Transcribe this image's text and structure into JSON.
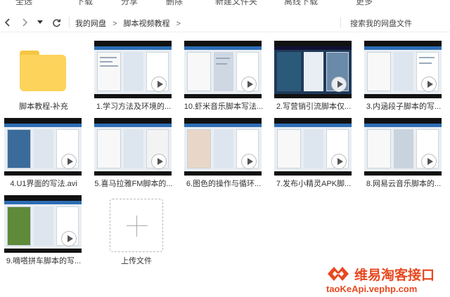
{
  "toolbar": {
    "items": [
      "全选",
      "下载",
      "分享",
      "删除",
      "新建文件夹",
      "离线下载",
      "更多"
    ]
  },
  "nav": {
    "back_icon": "chevron-left-icon",
    "forward_icon": "chevron-right-icon",
    "history_icon": "caret-down-icon",
    "refresh_icon": "refresh-icon",
    "breadcrumb": [
      "我的网盘",
      "脚本视频教程"
    ],
    "separator": ">",
    "search_placeholder": "搜索我的网盘文件"
  },
  "items": [
    {
      "name": "脚本教程-补充",
      "type": "folder"
    },
    {
      "name": "1.学习方法及环境的...",
      "type": "video"
    },
    {
      "name": "10.虾米音乐脚本写法...",
      "type": "video"
    },
    {
      "name": "2.写营销引流脚本仅...",
      "type": "video"
    },
    {
      "name": "3.内涵段子脚本的写...",
      "type": "video"
    },
    {
      "name": "4.U1界面的写法.avi",
      "type": "video"
    },
    {
      "name": "5.喜马拉雅FM脚本的...",
      "type": "video"
    },
    {
      "name": "6.图色的操作与循环...",
      "type": "video"
    },
    {
      "name": "7.发布小精灵APK脚...",
      "type": "video"
    },
    {
      "name": "8.网易云音乐脚本的...",
      "type": "video"
    },
    {
      "name": "9.嘀嗒拼车脚本的写...",
      "type": "video"
    }
  ],
  "upload": {
    "label": "上传文件",
    "icon": "plus-icon"
  },
  "watermark": {
    "title": "维易淘客接口",
    "url": "taoKeApi.vephp.com"
  },
  "colors": {
    "folder": "#fdd35b",
    "watermark": "#e8481f",
    "thumb_titlebar": "#2d6db5"
  }
}
